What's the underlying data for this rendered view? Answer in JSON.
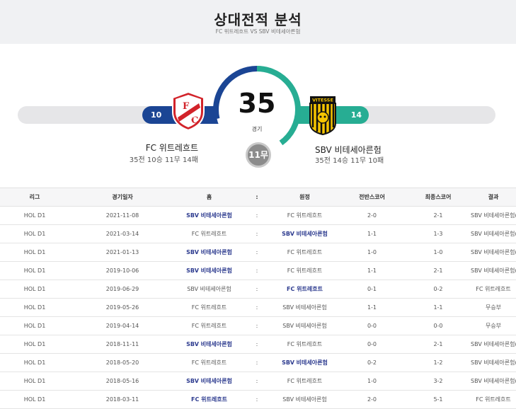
{
  "header": {
    "title": "상대전적 분석",
    "subtitle": "FC 위트레흐트 VS SBV 비테세아른험"
  },
  "summary": {
    "total": "35",
    "total_label": "경기",
    "draws": "11무",
    "home": {
      "wins": "10",
      "name": "FC 위트레흐트",
      "record": "35전 10승 11무 14패",
      "color": "#1b4594"
    },
    "away": {
      "wins": "14",
      "name": "SBV 비테세아른험",
      "record": "35전 14승 11무 10패",
      "color": "#27ad93"
    },
    "logos": {
      "home_letters": [
        "F",
        "C"
      ],
      "home_text": "UTRECHT",
      "away_text": "VITESSE"
    }
  },
  "table": {
    "headers": [
      "리그",
      "경기일자",
      "홈",
      ":",
      "원정",
      "전반스코어",
      "최종스코어",
      "결과"
    ],
    "rows": [
      {
        "league": "HOL D1",
        "date": "2021-11-08",
        "home": "SBV 비테세아른험",
        "sep": ":",
        "away": "FC 위트레흐트",
        "half": "2-0",
        "final": "2-1",
        "result": "SBV 비테세아른험(N)",
        "winner": "home"
      },
      {
        "league": "HOL D1",
        "date": "2021-03-14",
        "home": "FC 위트레흐트",
        "sep": ":",
        "away": "SBV 비테세아른험",
        "half": "1-1",
        "final": "1-3",
        "result": "SBV 비테세아른험(N)",
        "winner": "away"
      },
      {
        "league": "HOL D1",
        "date": "2021-01-13",
        "home": "SBV 비테세아른험",
        "sep": ":",
        "away": "FC 위트레흐트",
        "half": "1-0",
        "final": "1-0",
        "result": "SBV 비테세아른험(N)",
        "winner": "home"
      },
      {
        "league": "HOL D1",
        "date": "2019-10-06",
        "home": "SBV 비테세아른험",
        "sep": ":",
        "away": "FC 위트레흐트",
        "half": "1-1",
        "final": "2-1",
        "result": "SBV 비테세아른험(N)",
        "winner": "home"
      },
      {
        "league": "HOL D1",
        "date": "2019-06-29",
        "home": "SBV 비테세아른험",
        "sep": ":",
        "away": "FC 위트레흐트",
        "half": "0-1",
        "final": "0-2",
        "result": "FC 위트레흐트",
        "winner": "away"
      },
      {
        "league": "HOL D1",
        "date": "2019-05-26",
        "home": "FC 위트레흐트",
        "sep": ":",
        "away": "SBV 비테세아른험",
        "half": "1-1",
        "final": "1-1",
        "result": "무승부",
        "winner": "none"
      },
      {
        "league": "HOL D1",
        "date": "2019-04-14",
        "home": "FC 위트레흐트",
        "sep": ":",
        "away": "SBV 비테세아른험",
        "half": "0-0",
        "final": "0-0",
        "result": "무승부",
        "winner": "none"
      },
      {
        "league": "HOL D1",
        "date": "2018-11-11",
        "home": "SBV 비테세아른험",
        "sep": ":",
        "away": "FC 위트레흐트",
        "half": "0-0",
        "final": "2-1",
        "result": "SBV 비테세아른험(N)",
        "winner": "home"
      },
      {
        "league": "HOL D1",
        "date": "2018-05-20",
        "home": "FC 위트레흐트",
        "sep": ":",
        "away": "SBV 비테세아른험",
        "half": "0-2",
        "final": "1-2",
        "result": "SBV 비테세아른험(N)",
        "winner": "away"
      },
      {
        "league": "HOL D1",
        "date": "2018-05-16",
        "home": "SBV 비테세아른험",
        "sep": ":",
        "away": "FC 위트레흐트",
        "half": "1-0",
        "final": "3-2",
        "result": "SBV 비테세아른험(N)",
        "winner": "home"
      },
      {
        "league": "HOL D1",
        "date": "2018-03-11",
        "home": "FC 위트레흐트",
        "sep": ":",
        "away": "SBV 비테세아른험",
        "half": "2-0",
        "final": "5-1",
        "result": "FC 위트레흐트",
        "winner": "home"
      }
    ]
  }
}
